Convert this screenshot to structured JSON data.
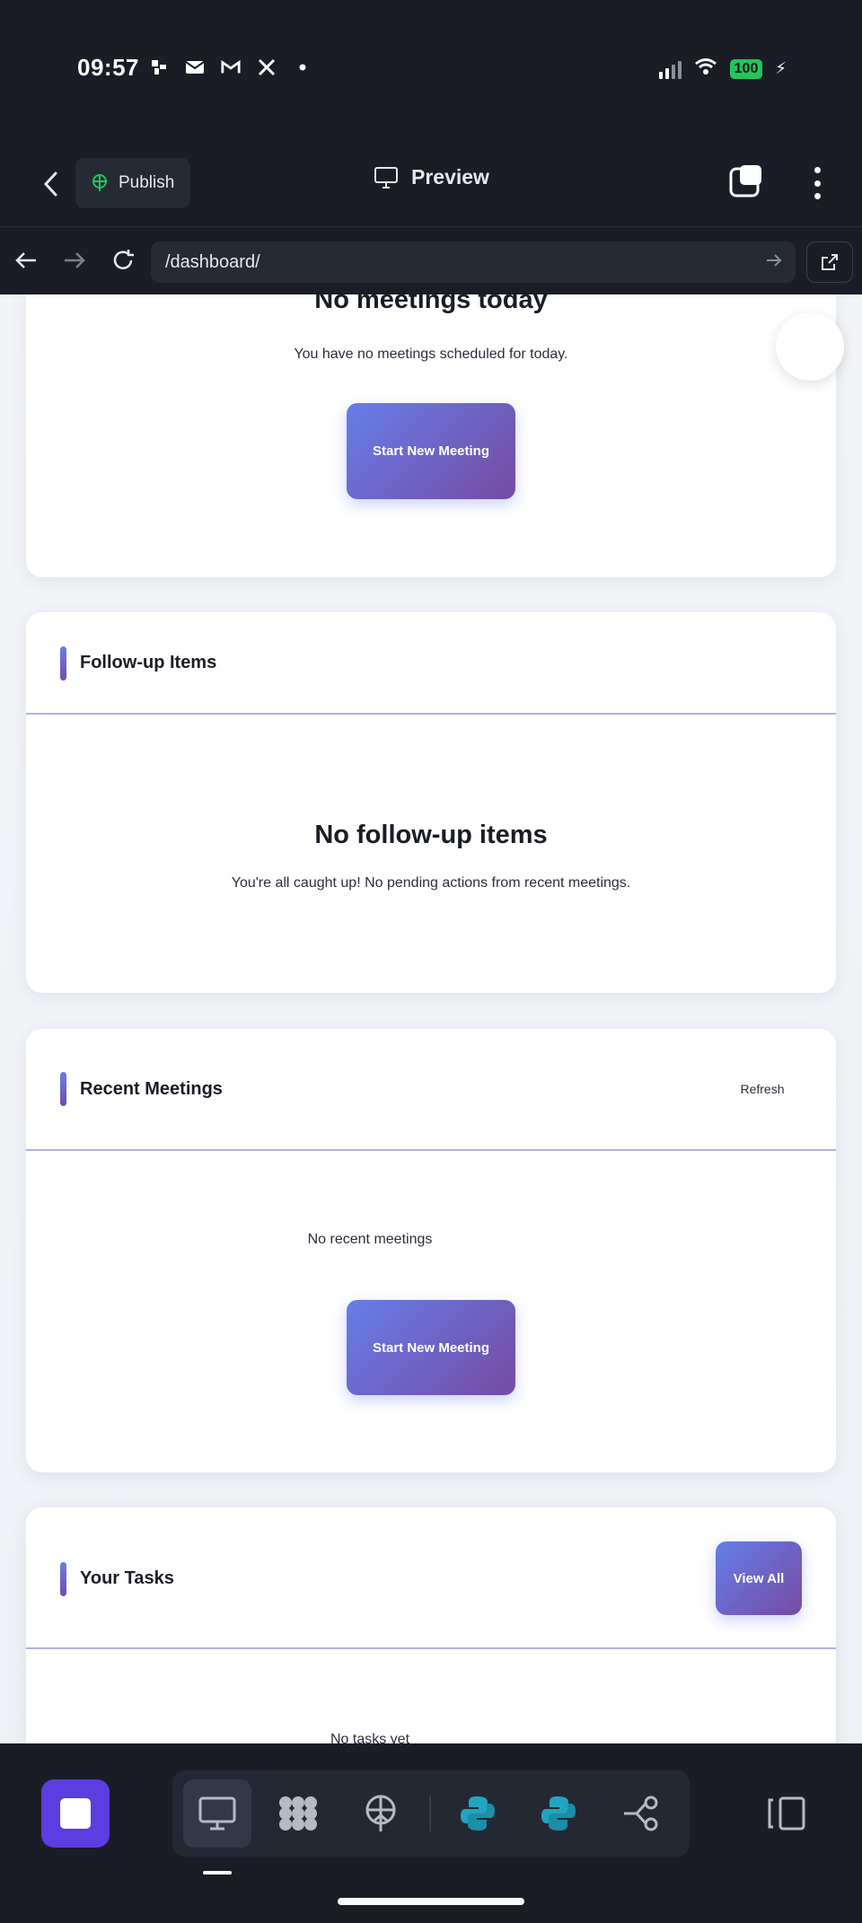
{
  "status_bar": {
    "time": "09:57",
    "notification_icons": [
      "slack-icon",
      "mail-icon",
      "gmail-icon",
      "x-icon",
      "dot-icon"
    ],
    "battery": "100"
  },
  "toolbar": {
    "publish_label": "Publish",
    "preview_label": "Preview"
  },
  "url_bar": {
    "url": "/dashboard/"
  },
  "meetings_today": {
    "heading": "No meetings today",
    "text": "You have no meetings scheduled for today.",
    "button_label": "Start New Meeting"
  },
  "follow_up": {
    "title": "Follow-up Items",
    "heading": "No follow-up items",
    "text": "You're all caught up! No pending actions from recent meetings."
  },
  "recent_meetings": {
    "title": "Recent Meetings",
    "refresh_label": "Refresh",
    "text": "No recent meetings",
    "button_label": "Start New Meeting"
  },
  "tasks": {
    "title": "Your Tasks",
    "view_all_label": "View All",
    "text": "No tasks yet"
  },
  "dock": {
    "items": [
      "monitor-icon",
      "app-grid-icon",
      "deploy-icon",
      "python-icon",
      "python-icon",
      "workflow-icon"
    ]
  },
  "colors": {
    "accent_start": "#667eea",
    "accent_end": "#764ba2",
    "dock_primary": "#5b3de0",
    "battery": "#22c55e"
  }
}
